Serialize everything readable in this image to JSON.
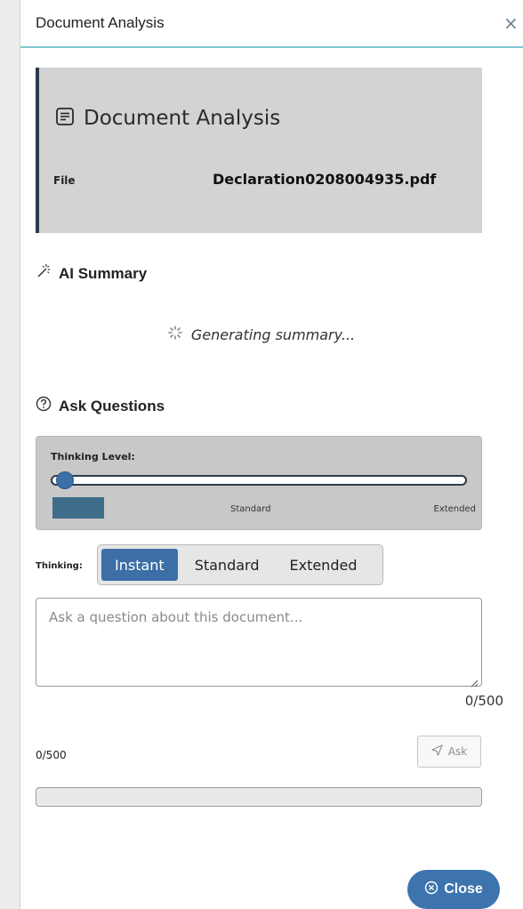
{
  "panel": {
    "title": "Document Analysis",
    "close_glyph": "×"
  },
  "card": {
    "icon": "document-icon",
    "title": "Document Analysis",
    "file_label": "File",
    "file_name": "Declaration0208004935.pdf"
  },
  "ai_summary": {
    "icon": "magic-wand-icon",
    "heading": "AI Summary",
    "status": "Generating summary..."
  },
  "ask": {
    "icon": "help-circle-icon",
    "heading": "Ask Questions",
    "thinking_level_label": "Thinking Level:",
    "slider_value": 0,
    "slider_ticks": [
      "Standard",
      "Extended"
    ],
    "thinking_label": "Thinking:",
    "modes": [
      {
        "label": "Instant",
        "active": true
      },
      {
        "label": "Standard",
        "active": false
      },
      {
        "label": "Extended",
        "active": false
      }
    ],
    "placeholder": "Ask a question about this document...",
    "counter_right": "0/500",
    "counter_left": "0/500",
    "ask_button": "Ask",
    "progress": 0
  },
  "footer": {
    "close_button": "Close"
  },
  "colors": {
    "accent": "#3b6fa6",
    "header_rule": "#7fc6cf",
    "card_border": "#2d3b4d"
  }
}
